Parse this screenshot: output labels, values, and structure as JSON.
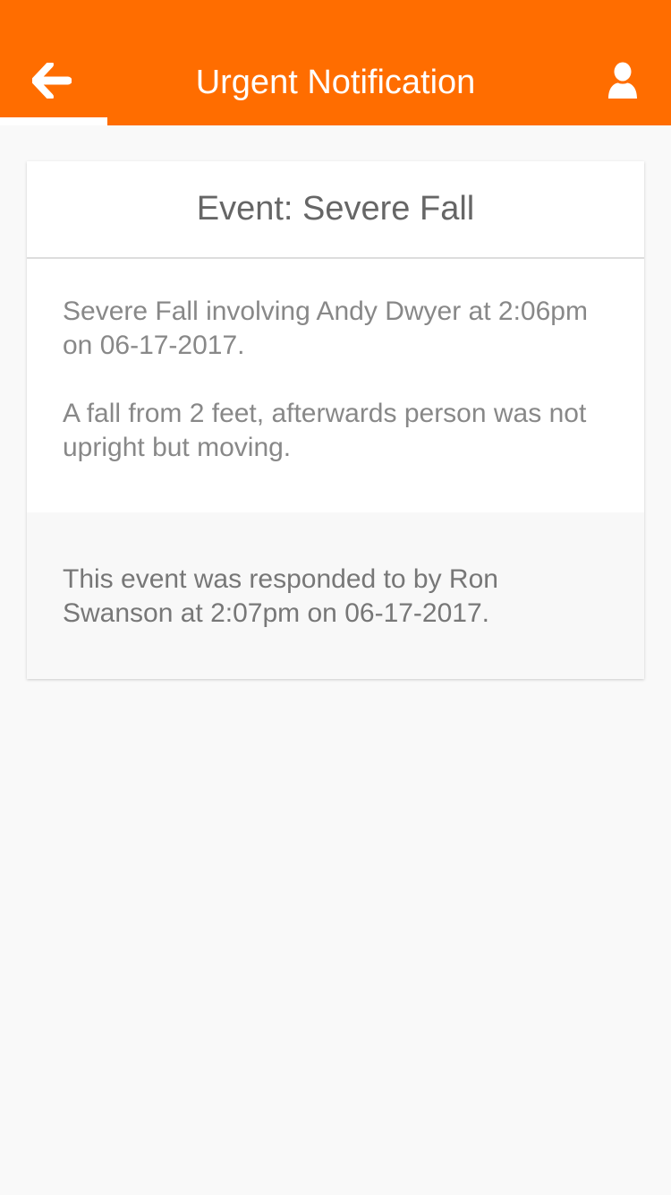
{
  "header": {
    "title": "Urgent Notification",
    "back_icon": "arrow-left-icon",
    "profile_icon": "user-icon",
    "background_color": "#ff6d00",
    "text_color": "#ffffff"
  },
  "event": {
    "title": "Event: Severe Fall",
    "description": "Severe Fall involving Andy Dwyer at 2:06pm on 06-17-2017.",
    "details": "A fall from 2 feet, afterwards person was not upright but moving.",
    "response": "This event was responded to by Ron Swanson at 2:07pm on 06-17-2017."
  }
}
